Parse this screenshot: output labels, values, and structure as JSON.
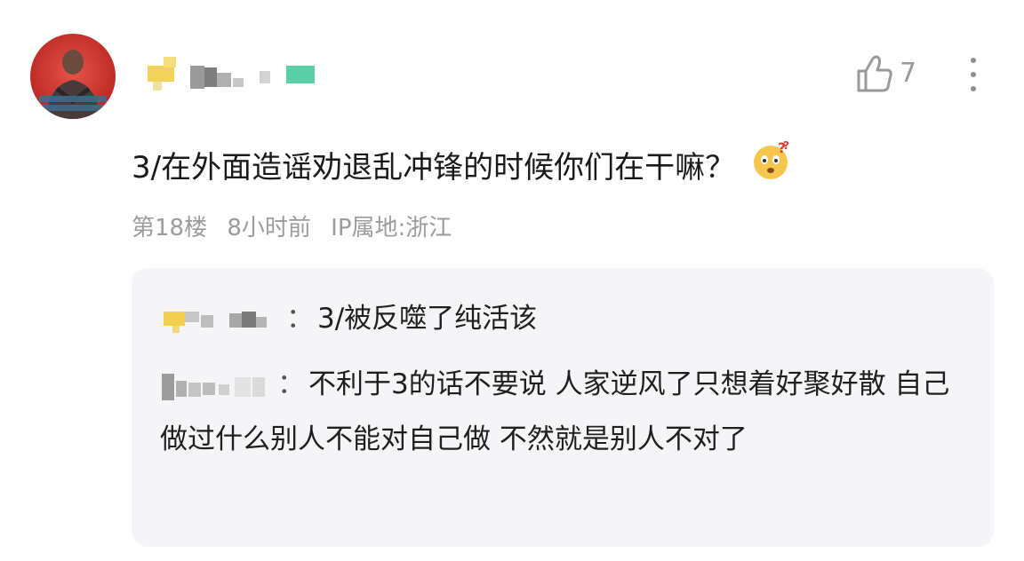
{
  "comment": {
    "like_count": "7",
    "text": "3/在外面造谣劝退乱冲锋的时候你们在干嘛？",
    "emoji": "confused-face-emoji",
    "meta": {
      "floor": "第18楼",
      "time": "8小时前",
      "ip": "IP属地:浙江"
    }
  },
  "replies": [
    {
      "separator": "：",
      "text": "3/被反噬了纯活该"
    },
    {
      "separator": "：",
      "text": "不利于3的话不要说 人家逆风了只想着好聚好散 自己做过什么别人不能对自己做 不然就是别人不对了"
    }
  ],
  "icons": {
    "like": "thumbs-up-icon",
    "more": "vertical-dots-icon"
  },
  "colors": {
    "meta_text": "#9c9c9c",
    "reply_bg": "#f5f5f7",
    "emoji_yellow": "#f7c64c"
  }
}
